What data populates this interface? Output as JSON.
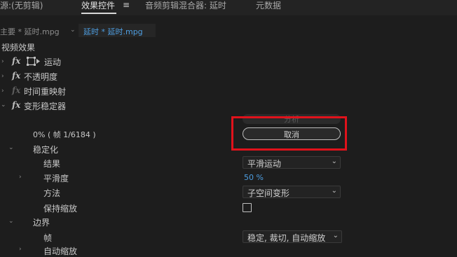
{
  "tabs": [
    {
      "label": "源:(无剪辑)"
    },
    {
      "label": "效果控件"
    },
    {
      "label": "音频剪辑混合器: 延时"
    },
    {
      "label": "元数据"
    }
  ],
  "menu_icon": "≡",
  "clip_tabs": {
    "master": "主要 * 延时.mpg",
    "dropdown_icon": "chevron-down-icon",
    "active": "延时 * 延时.mpg"
  },
  "section_header": "视频效果",
  "effects": [
    {
      "label": "运动",
      "fx": "fx",
      "has_transform_icon": true
    },
    {
      "label": "不透明度",
      "fx": "fx"
    },
    {
      "label": "时间重映射",
      "fx": "fx"
    },
    {
      "label": "变形稳定器",
      "fx": "fx"
    }
  ],
  "stabilizer": {
    "analyze_label": "分析",
    "progress_text": "0% ( 帧 1/6184 )",
    "cancel_label": "取消",
    "stabilization_group": "稳定化",
    "result_label": "结果",
    "result_value": "平滑运动",
    "smoothness_label": "平滑度",
    "smoothness_value": "50 %",
    "method_label": "方法",
    "method_value": "子空间变形",
    "preserve_scale_label": "保持缩放",
    "preserve_scale_checked": false,
    "border_group": "边界",
    "frame_label": "帧",
    "frame_value": "稳定, 裁切, 自动缩放",
    "partial_label": "自动缩放"
  },
  "colors": {
    "highlight_box": "#e0121b",
    "link_blue": "#4d9de0",
    "background": "#1d1d1d"
  }
}
